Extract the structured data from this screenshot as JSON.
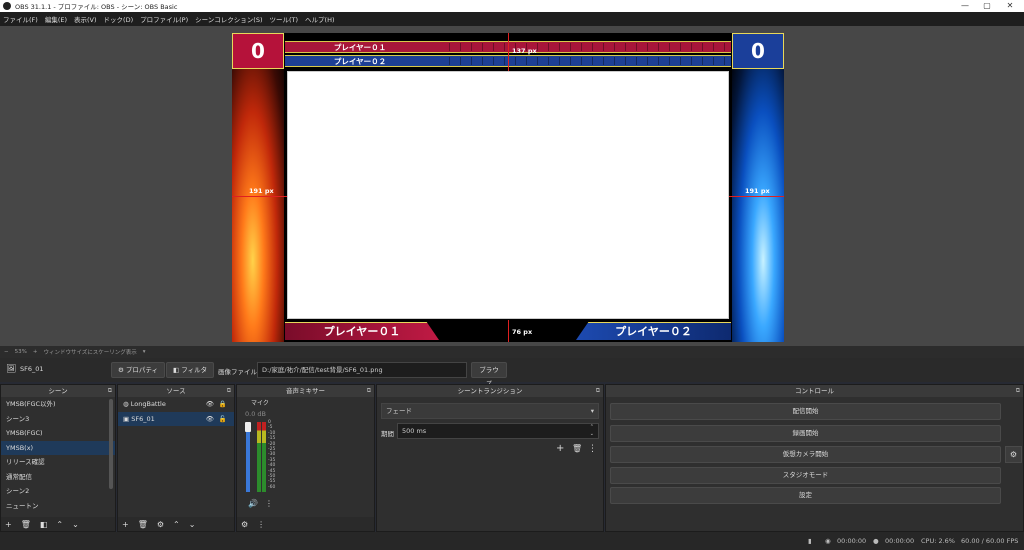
{
  "window": {
    "title": "OBS 31.1.1 - プロファイル: OBS - シーン: OBS Basic",
    "min": "—",
    "max": "▢",
    "close": "✕"
  },
  "menu": [
    "ファイル(F)",
    "編集(E)",
    "表示(V)",
    "ドック(D)",
    "プロファイル(P)",
    "シーンコレクション(S)",
    "ツール(T)",
    "ヘルプ(H)"
  ],
  "overlay": {
    "score_left": "0",
    "score_right": "0",
    "player1": "プレイヤー０１",
    "player2": "プレイヤー０２",
    "bottom_player1": "プレイヤー０１",
    "bottom_player2": "プレイヤー０２",
    "measure_top": "137 px",
    "measure_left": "191 px",
    "measure_right": "191 px",
    "measure_bottom": "76 px",
    "colors": {
      "p1": "#b5123a",
      "p2": "#1b3f9a",
      "border": "#e8d85a"
    }
  },
  "preview_bar": {
    "minus": "−",
    "zoom": "53%",
    "plus": "+",
    "mode": "ウィンドウサイズにスケーリング表示",
    "dropdown": "▾"
  },
  "toolbar": {
    "source_name": "SF6_01",
    "properties": "プロパティ",
    "filters": "フィルタ",
    "image_file_label": "画像ファイル",
    "path": "D:/家庭/祐介/配信/test背景/SF6_01.png",
    "browse": "ブラウズ"
  },
  "scenes": {
    "title": "シーン",
    "items": [
      "YMSB(FGC以外)",
      "シーン3",
      "YMSB(FGC)",
      "YMSB(x)",
      "リリース確認",
      "通常配信",
      "シーン2",
      "ニュートン"
    ],
    "selected": 3
  },
  "sources": {
    "title": "ソース",
    "items": [
      {
        "name": "LongBattle",
        "icon": "globe-icon"
      },
      {
        "name": "SF6_01",
        "icon": "image-icon"
      }
    ],
    "selected": 1
  },
  "mixer": {
    "title": "音声ミキサー",
    "channel": "マイク",
    "level": "0.0 dB",
    "ticks": [
      "0",
      "-5",
      "-10",
      "-15",
      "-20",
      "-25",
      "-30",
      "-35",
      "-40",
      "-45",
      "-50",
      "-55",
      "-60"
    ]
  },
  "transitions": {
    "title": "シーントランジション",
    "type": "フェード",
    "duration_label": "期間",
    "duration": "500 ms"
  },
  "controls": {
    "title": "コントロール",
    "buttons": [
      "配信開始",
      "録画開始",
      "仮想カメラ開始",
      "スタジオモード",
      "設定"
    ]
  },
  "status": {
    "stream_time": "00:00:00",
    "rec_time": "00:00:00",
    "cpu": "CPU: 2.6%",
    "fps": "60.00 / 60.00 FPS"
  }
}
